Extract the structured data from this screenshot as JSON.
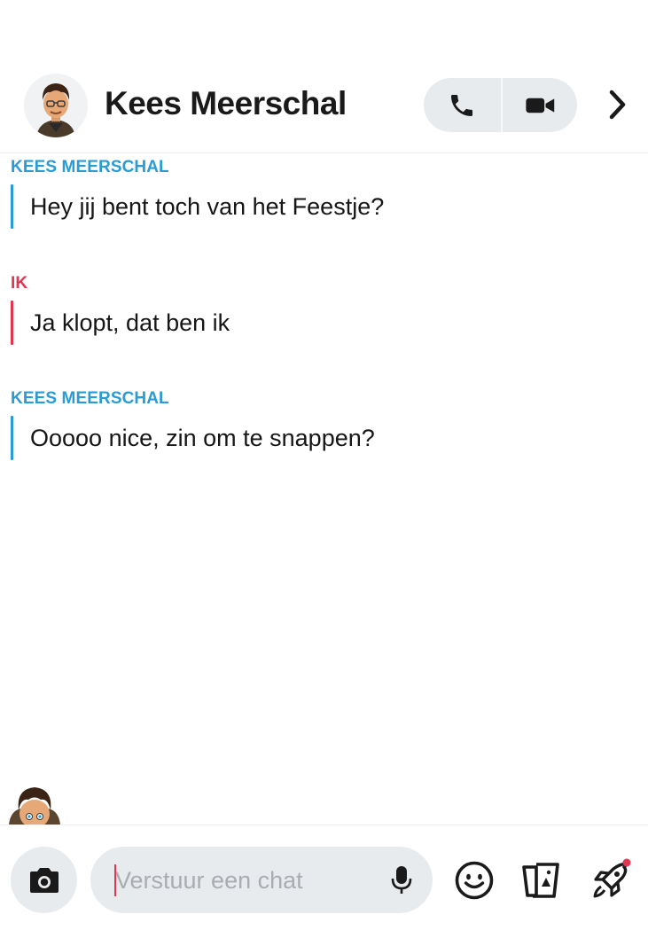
{
  "header": {
    "contact_name": "Kees Meerschal",
    "avatar_icon": "bitmoji-avatar-icon",
    "voice_call_icon": "phone-icon",
    "video_call_icon": "video-camera-icon",
    "more_icon": "chevron-right-icon"
  },
  "messages": [
    {
      "sender": "KEES MEERSCHAL",
      "text": "Hey jij bent toch van het Feestje?",
      "from_me": false
    },
    {
      "sender": "IK",
      "text": "Ja klopt, dat ben ik",
      "from_me": true
    },
    {
      "sender": "KEES MEERSCHAL",
      "text": "Ooooo nice, zin om te snappen?",
      "from_me": false
    }
  ],
  "composer": {
    "placeholder": "Verstuur een chat",
    "value": "",
    "camera_icon": "camera-icon",
    "mic_icon": "microphone-icon",
    "emoji_icon": "smiley-icon",
    "memories_icon": "memories-cards-icon",
    "games_icon": "rocket-icon"
  },
  "colors": {
    "them": "#2b9bd3",
    "me": "#e0364f",
    "button_bg": "#e8ebee",
    "notification_dot": "#e0364f"
  }
}
